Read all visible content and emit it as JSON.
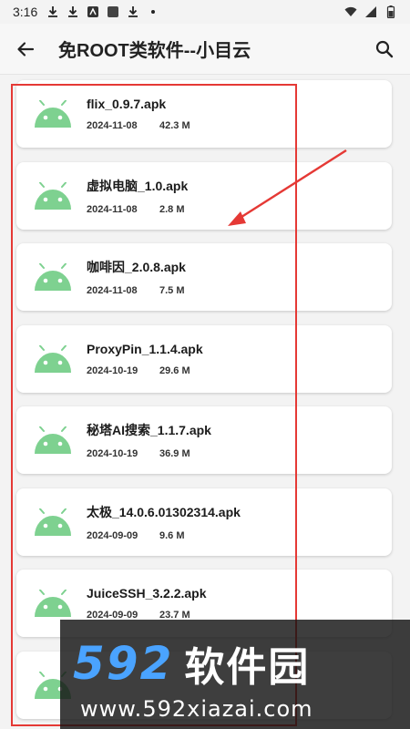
{
  "status_bar": {
    "time": "3:16"
  },
  "app_bar": {
    "title": "免ROOT类软件--小目云"
  },
  "files": [
    {
      "name": "flix_0.9.7.apk",
      "date": "2024-11-08",
      "size": "42.3 M"
    },
    {
      "name": "虚拟电脑_1.0.apk",
      "date": "2024-11-08",
      "size": "2.8 M"
    },
    {
      "name": "咖啡因_2.0.8.apk",
      "date": "2024-11-08",
      "size": "7.5 M"
    },
    {
      "name": "ProxyPin_1.1.4.apk",
      "date": "2024-10-19",
      "size": "29.6 M"
    },
    {
      "name": "秘塔AI搜索_1.1.7.apk",
      "date": "2024-10-19",
      "size": "36.9 M"
    },
    {
      "name": "太极_14.0.6.01302314.apk",
      "date": "2024-09-09",
      "size": "9.6 M"
    },
    {
      "name": "JuiceSSH_3.2.2.apk",
      "date": "2024-09-09",
      "size": "23.7 M"
    },
    {
      "name": "",
      "date": "",
      "size": ""
    }
  ],
  "watermark": {
    "number": "592",
    "name": "软件园",
    "url": "www.592xiazai.com"
  },
  "colors": {
    "android_icon": "#7ed190",
    "highlight": "#e53935",
    "watermark_blue": "#4aa3ff"
  },
  "icons": {
    "file_icon": "android-icon",
    "back": "arrow-left-icon",
    "search": "search-icon"
  }
}
